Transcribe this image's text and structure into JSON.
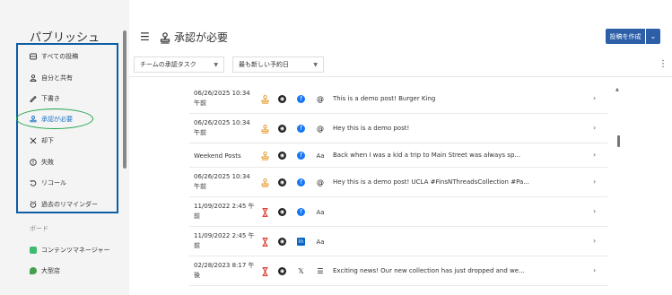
{
  "sidebar": {
    "title": "パブリッシュ",
    "items": [
      {
        "label": "すべての投稿",
        "icon": "inbox-icon"
      },
      {
        "label": "自分と共有",
        "icon": "shared-icon"
      },
      {
        "label": "下書き",
        "icon": "draft-icon"
      },
      {
        "label": "承認が必要",
        "icon": "stamp-icon",
        "active": true
      },
      {
        "label": "却下",
        "icon": "reject-icon"
      },
      {
        "label": "失敗",
        "icon": "failed-icon"
      },
      {
        "label": "リコール",
        "icon": "recall-icon"
      },
      {
        "label": "過去のリマインダー",
        "icon": "reminder-icon"
      }
    ],
    "boards_label": "ボード",
    "boards": [
      {
        "label": "コンテンツマネージャー",
        "icon": "board-icon"
      },
      {
        "label": "大型店",
        "icon": "leaf-icon"
      }
    ]
  },
  "header": {
    "title": "承認が必要",
    "create_label": "投稿を作成"
  },
  "filters": {
    "task": "チームの承認タスク",
    "sort": "最も新しい予約日"
  },
  "rows": [
    {
      "date": "06/26/2025 10:34 午前",
      "status": "pending",
      "network": "facebook",
      "fmt": "threads",
      "text": "This is a demo post! Burger King"
    },
    {
      "date": "06/26/2025 10:34 午前",
      "status": "pending",
      "network": "facebook",
      "fmt": "threads",
      "text": "Hey this is a demo post!"
    },
    {
      "date": "Weekend Posts",
      "status": "pending",
      "network": "facebook",
      "fmt": "Aa",
      "text": "Back when I was a kid a trip to Main Street was always sp..."
    },
    {
      "date": "06/26/2025 10:34 午前",
      "status": "pending",
      "network": "facebook",
      "fmt": "threads",
      "text": "Hey this is a demo post! UCLA #FinsNThreadsCollection #Pa..."
    },
    {
      "date": "11/09/2022 2:45 午前",
      "status": "waiting",
      "network": "facebook",
      "fmt": "Aa",
      "text": ""
    },
    {
      "date": "11/09/2022 2:45 午前",
      "status": "waiting",
      "network": "linkedin",
      "fmt": "Aa",
      "text": ""
    },
    {
      "date": "02/28/2023 8:17 午後",
      "status": "waiting",
      "network": "x",
      "fmt": "threads",
      "text": "Exciting news! Our new collection has just dropped and we..."
    }
  ],
  "colors": {
    "accent": "#2c5fa8",
    "highlight_box": "#0d5ea6",
    "active_oval": "#1aa34a",
    "pending_stamp": "#e8a035",
    "waiting_glass": "#d93025"
  }
}
